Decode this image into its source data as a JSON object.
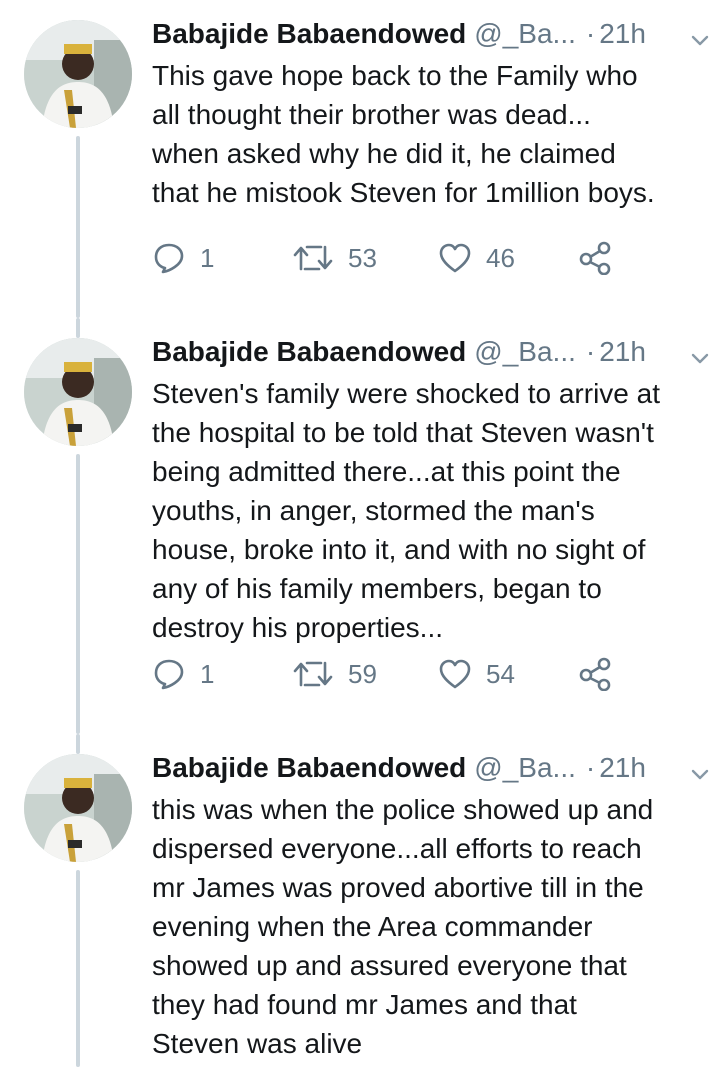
{
  "tweets": [
    {
      "name": "Babajide Babaendowed",
      "handle": "@_Ba...",
      "separator": "·",
      "time": "21h",
      "text": "This gave hope back to the Family who\nall thought their brother was dead...\nwhen asked why he did it, he claimed\nthat he mistook Steven for 1million boys.",
      "replies": "1",
      "retweets": "53",
      "likes": "46"
    },
    {
      "name": "Babajide Babaendowed",
      "handle": "@_Ba...",
      "separator": "·",
      "time": "21h",
      "text": "Steven's family were shocked to arrive at\nthe hospital to be told that Steven wasn't\nbeing admitted there...at this point the\nyouths, in anger, stormed the man's\nhouse, broke into it, and with no sight of\nany of his family members, began to\ndestroy his properties...",
      "replies": "1",
      "retweets": "59",
      "likes": "54"
    },
    {
      "name": "Babajide Babaendowed",
      "handle": "@_Ba...",
      "separator": "·",
      "time": "21h",
      "text": "this was when the police showed up and\ndispersed everyone...all efforts to reach\nmr James was proved abortive till in the\nevening when the Area commander\nshowed up and assured everyone that\nthey had found mr James and that\nSteven was alive"
    }
  ],
  "colors": {
    "text": "#14171a",
    "muted": "#657786",
    "thread": "#ccd6dd"
  },
  "icons": [
    "reply-icon",
    "retweet-icon",
    "like-icon",
    "share-icon",
    "caret-down-icon"
  ]
}
